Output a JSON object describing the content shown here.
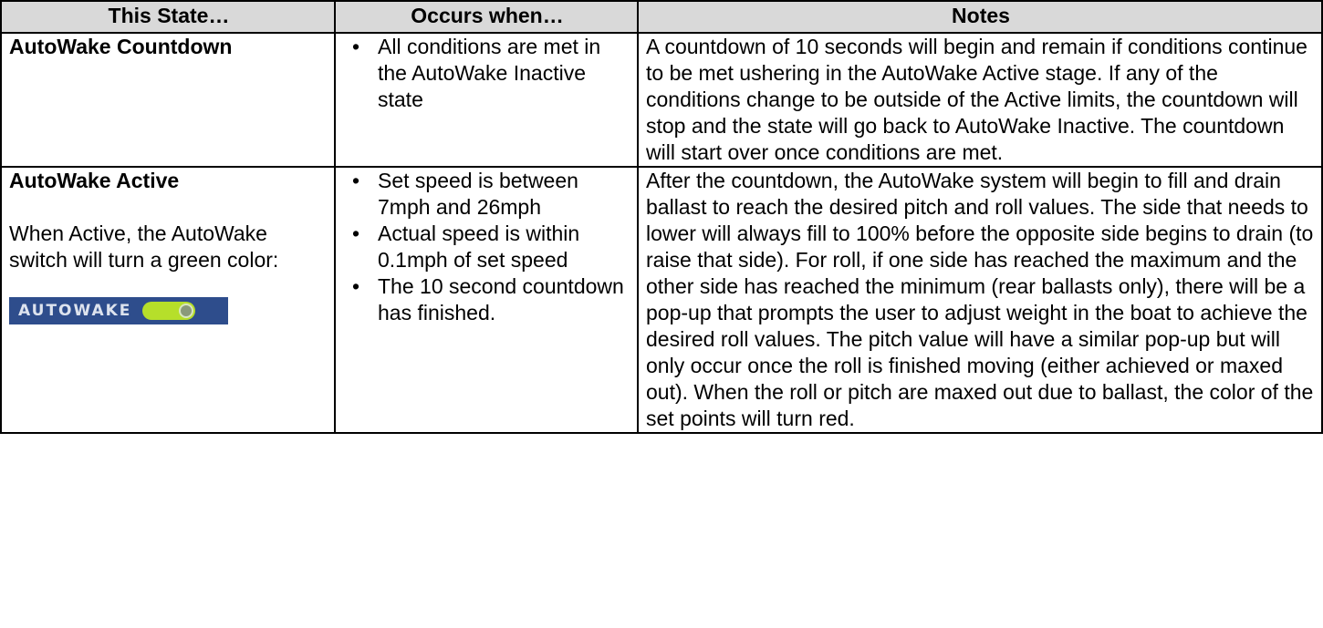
{
  "headers": [
    "This State…",
    "Occurs when…",
    "Notes"
  ],
  "rows": [
    {
      "state": "AutoWake Countdown",
      "conditions": [
        "All conditions are met in the AutoWake Inactive state"
      ],
      "notes": "A countdown of 10 seconds will begin and remain if conditions continue to be met ushering in the AutoWake Active stage. If any of the conditions change to be outside of the Active limits, the countdown will stop and the state will go back to AutoWake Inactive. The countdown will start over once conditions are met."
    },
    {
      "state": "AutoWake Active",
      "description": "When Active, the AutoWake switch will turn a green color:",
      "switch_label": "AUTOWAKE",
      "switch_color": "#b6df2a",
      "conditions": [
        "Set speed is between 7mph and 26mph",
        "Actual speed is within 0.1mph of set speed",
        "The 10 second countdown has finished."
      ],
      "notes": "After the countdown, the AutoWake system will begin to fill and drain ballast to reach the desired pitch and roll values. The side that needs to lower will always fill to 100% before the opposite side begins to drain (to raise that side). For roll, if one side has reached the maximum and the other side has reached the minimum (rear ballasts only), there will be a pop-up that prompts the user to adjust weight in the boat to achieve the desired roll values. The pitch value will have a similar pop-up but will only occur once the roll is finished moving (either achieved or maxed out). When the roll or pitch are maxed out due to ballast, the color of the set points will turn red."
    }
  ]
}
